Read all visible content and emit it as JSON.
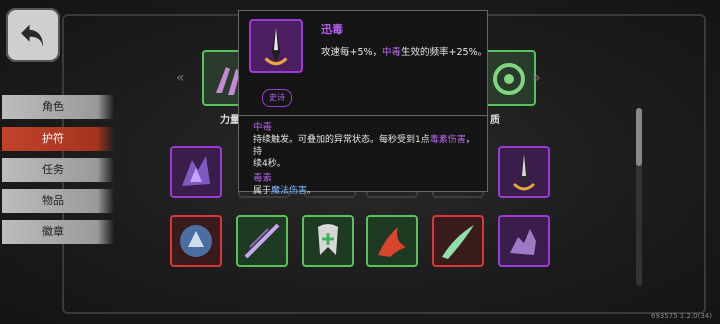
{
  "tabs": [
    {
      "label": "角色",
      "active": false
    },
    {
      "label": "护符",
      "active": true
    },
    {
      "label": "任务",
      "active": false
    },
    {
      "label": "物品",
      "active": false
    },
    {
      "label": "徽章",
      "active": false
    }
  ],
  "top_labels": {
    "left": "力量",
    "right": "质"
  },
  "tooltip": {
    "name": "迅毒",
    "desc_prefix": "攻速每+5%，",
    "desc_highlight": "中毒",
    "desc_suffix": "生效的频率+25%。",
    "rarity": "史诗",
    "section1_title": "中毒",
    "section1_line1": "持续触发。可叠加的异常状态。每秒受到1点",
    "section1_hl": "毒素伤害",
    "section1_line1b": "，持",
    "section1_line2": "续4秒。",
    "section2_title": "毒素",
    "section2_prefix": "属于",
    "section2_hl": "魔法伤害",
    "section2_suffix": "。"
  },
  "version": "693575 1.2.0(34)",
  "colors": {
    "epic": "#9b3bd6",
    "uncommon": "#57c45a",
    "rare_red": "#d9383a",
    "active_tab": "#c1432c"
  }
}
